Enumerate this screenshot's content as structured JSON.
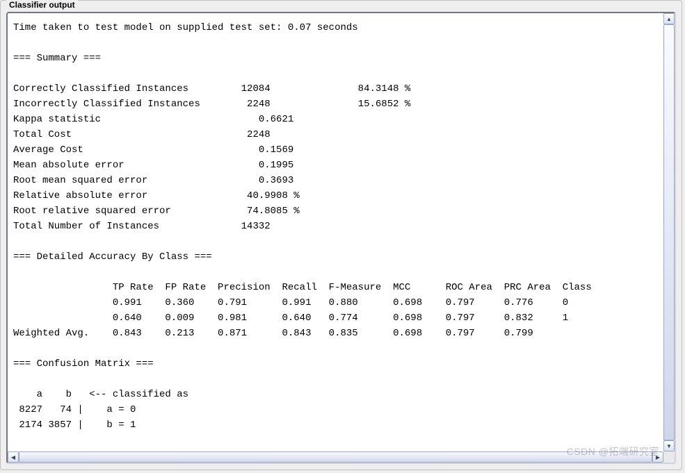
{
  "panel": {
    "title": "Classifier output"
  },
  "watermark": "CSDN @拓端研究室",
  "output": {
    "test_time_line": "Time taken to test model on supplied test set: 0.07 seconds",
    "summary_header": "=== Summary ===",
    "summary": {
      "correct_label": "Correctly Classified Instances",
      "correct_count": "12084",
      "correct_pct": "84.3148 %",
      "incorrect_label": "Incorrectly Classified Instances",
      "incorrect_count": "2248",
      "incorrect_pct": "15.6852 %",
      "kappa_label": "Kappa statistic",
      "kappa_value": "0.6621",
      "total_cost_label": "Total Cost",
      "total_cost_value": "2248",
      "avg_cost_label": "Average Cost",
      "avg_cost_value": "0.1569",
      "mae_label": "Mean absolute error",
      "mae_value": "0.1995",
      "rmse_label": "Root mean squared error",
      "rmse_value": "0.3693",
      "rae_label": "Relative absolute error",
      "rae_value": "40.9908 %",
      "rrse_label": "Root relative squared error",
      "rrse_value": "74.8085 %",
      "total_label": "Total Number of Instances",
      "total_value": "14332"
    },
    "detail_header": "=== Detailed Accuracy By Class ===",
    "detail_columns": [
      "TP Rate",
      "FP Rate",
      "Precision",
      "Recall",
      "F-Measure",
      "MCC",
      "ROC Area",
      "PRC Area",
      "Class"
    ],
    "detail_rows": [
      {
        "label": "",
        "tp": "0.991",
        "fp": "0.360",
        "prec": "0.791",
        "rec": "0.991",
        "fm": "0.880",
        "mcc": "0.698",
        "roc": "0.797",
        "prc": "0.776",
        "class": "0"
      },
      {
        "label": "",
        "tp": "0.640",
        "fp": "0.009",
        "prec": "0.981",
        "rec": "0.640",
        "fm": "0.774",
        "mcc": "0.698",
        "roc": "0.797",
        "prc": "0.832",
        "class": "1"
      },
      {
        "label": "Weighted Avg.",
        "tp": "0.843",
        "fp": "0.213",
        "prec": "0.871",
        "rec": "0.843",
        "fm": "0.835",
        "mcc": "0.698",
        "roc": "0.797",
        "prc": "0.799",
        "class": ""
      }
    ],
    "confusion_header": "=== Confusion Matrix ===",
    "confusion": {
      "header_line": "    a    b   <-- classified as",
      "rows": [
        " 8227   74 |    a = 0",
        " 2174 3857 |    b = 1"
      ]
    }
  }
}
